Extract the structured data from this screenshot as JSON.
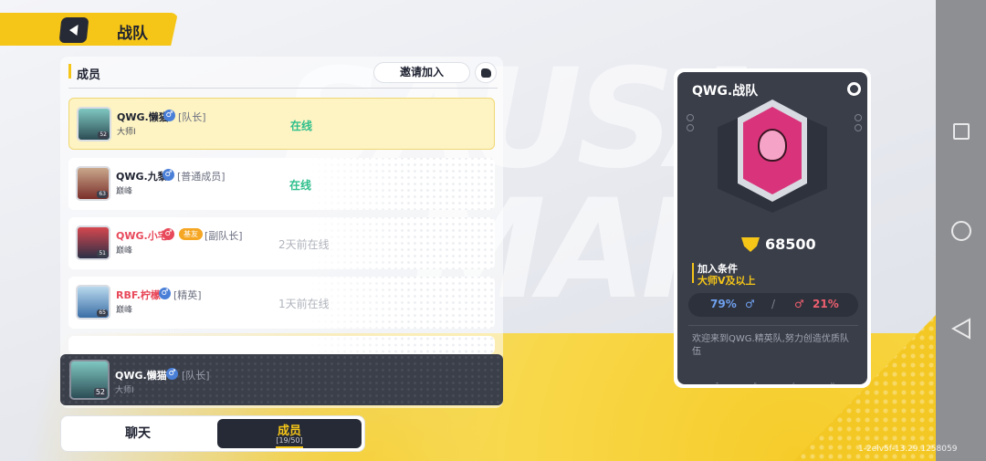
{
  "header": {
    "title": "战队"
  },
  "panel": {
    "title": "成员",
    "invite_label": "邀请加入"
  },
  "members": [
    {
      "name": "QWG.懒猫",
      "gender": "♂",
      "role": "[队长]",
      "rank": "大师I",
      "status": "在线",
      "level": "52",
      "selected": true
    },
    {
      "name": "QWG.九黎",
      "gender": "♂",
      "role": "[普通成员]",
      "rank": "巅峰",
      "status": "在线",
      "level": "63"
    },
    {
      "name": "QWG.小宅",
      "gender": "♂",
      "badge": "基友",
      "role": "[副队长]",
      "rank": "巅峰",
      "status": "2天前在线",
      "level": "51"
    },
    {
      "name": "RBF.柠檬",
      "gender": "♂",
      "role": "[精英]",
      "rank": "巅峰",
      "status": "1天前在线",
      "level": "65"
    }
  ],
  "self": {
    "name": "QWG.懒猫",
    "gender": "♂",
    "role": "[队长]",
    "rank": "大师I",
    "level": "52"
  },
  "tabs": {
    "chat": "聊天",
    "members": "成员",
    "members_count": "[19/50]"
  },
  "team": {
    "name": "QWG.战队",
    "score": "68500",
    "join_title": "加入条件",
    "join_value": "大师V及以上",
    "male_ratio": "79%",
    "male_icon": "♂",
    "separator": "/",
    "female_icon": "♂",
    "female_ratio": "21%",
    "description": "欢迎来到QWG.精英队,努力创造优质队伍",
    "footer_letters": [
      "T",
      "E",
      "A",
      "M"
    ]
  },
  "version": "1-2elv5f-13.29.1258059",
  "colors": {
    "accent": "#f5c518",
    "online": "#2fbf8c",
    "dark": "#3a3e49"
  }
}
